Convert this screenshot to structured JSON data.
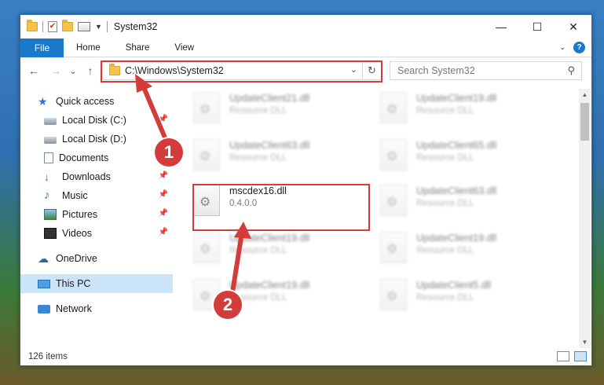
{
  "window": {
    "title": "System32",
    "controls": {
      "minimize": "—",
      "maximize": "☐",
      "close": "✕"
    }
  },
  "ribbon": {
    "tabs": [
      "File",
      "Home",
      "Share",
      "View"
    ],
    "expand_icon": "chevron-down-icon",
    "help_label": "?"
  },
  "nav": {
    "back": "←",
    "forward": "→",
    "recent": "⌄",
    "up": "↑",
    "address": "C:\\Windows\\System32",
    "search_placeholder": "Search System32"
  },
  "sidebar": {
    "items": [
      {
        "label": "Quick access",
        "icon": "star-icon"
      },
      {
        "label": "Local Disk (C:)",
        "icon": "disk-icon",
        "pinned": true
      },
      {
        "label": "Local Disk (D:)",
        "icon": "disk-icon"
      },
      {
        "label": "Documents",
        "icon": "documents-icon"
      },
      {
        "label": "Downloads",
        "icon": "downloads-icon",
        "pinned": true
      },
      {
        "label": "Music",
        "icon": "music-icon",
        "pinned": true
      },
      {
        "label": "Pictures",
        "icon": "pictures-icon",
        "pinned": true
      },
      {
        "label": "Videos",
        "icon": "videos-icon",
        "pinned": true
      },
      {
        "label": "OneDrive",
        "icon": "onedrive-icon"
      },
      {
        "label": "This PC",
        "icon": "this-pc-icon",
        "selected": true
      },
      {
        "label": "Network",
        "icon": "network-icon"
      }
    ]
  },
  "files": [
    {
      "name": "UpdateClient21.dll",
      "desc": "Resource DLL",
      "blurred": true
    },
    {
      "name": "UpdateClient19.dll",
      "desc": "Resource DLL",
      "blurred": true
    },
    {
      "name": "UpdateClient63.dll",
      "desc": "Resource DLL",
      "blurred": true
    },
    {
      "name": "UpdateClient65.dll",
      "desc": "Resource DLL",
      "blurred": true
    },
    {
      "name": "mscdex16.dll",
      "desc": "0.4.0.0",
      "blurred": false
    },
    {
      "name": "UpdateClient63.dll",
      "desc": "Resource DLL",
      "blurred": true
    },
    {
      "name": "UpdateClient19.dll",
      "desc": "Resource DLL",
      "blurred": true
    },
    {
      "name": "UpdateClient19.dll",
      "desc": "Resource DLL",
      "blurred": true
    },
    {
      "name": "UpdateClient19.dll",
      "desc": "Resource DLL",
      "blurred": true
    },
    {
      "name": "UpdateClient5.dll",
      "desc": "Resource DLL",
      "blurred": true
    }
  ],
  "status": {
    "item_count": "126 items"
  },
  "annotations": {
    "step1": "1",
    "step2": "2",
    "color": "#d43b3b"
  }
}
